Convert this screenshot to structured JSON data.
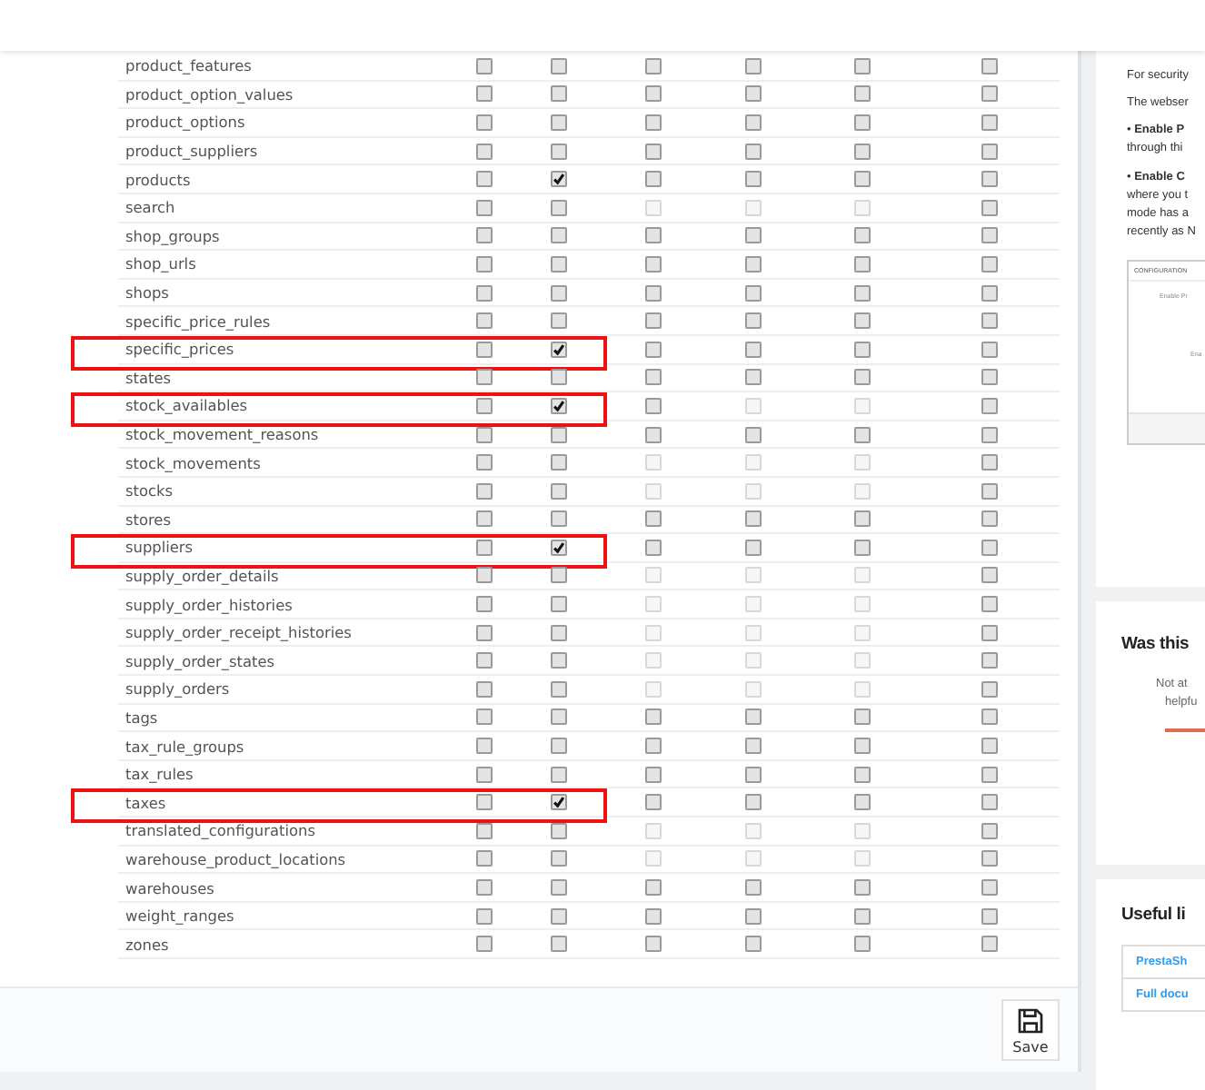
{
  "table": {
    "rows": [
      {
        "name": "product_features",
        "highlighted": false,
        "checked": [
          false,
          false,
          false,
          false,
          false,
          false
        ],
        "disabled": [
          false,
          false,
          false,
          false,
          false,
          false
        ]
      },
      {
        "name": "product_option_values",
        "highlighted": false,
        "checked": [
          false,
          false,
          false,
          false,
          false,
          false
        ],
        "disabled": [
          false,
          false,
          false,
          false,
          false,
          false
        ]
      },
      {
        "name": "product_options",
        "highlighted": false,
        "checked": [
          false,
          false,
          false,
          false,
          false,
          false
        ],
        "disabled": [
          false,
          false,
          false,
          false,
          false,
          false
        ]
      },
      {
        "name": "product_suppliers",
        "highlighted": false,
        "checked": [
          false,
          false,
          false,
          false,
          false,
          false
        ],
        "disabled": [
          false,
          false,
          false,
          false,
          false,
          false
        ]
      },
      {
        "name": "products",
        "highlighted": false,
        "checked": [
          false,
          true,
          false,
          false,
          false,
          false
        ],
        "disabled": [
          false,
          false,
          false,
          false,
          false,
          false
        ]
      },
      {
        "name": "search",
        "highlighted": false,
        "checked": [
          false,
          false,
          false,
          false,
          false,
          false
        ],
        "disabled": [
          false,
          false,
          true,
          true,
          true,
          false
        ]
      },
      {
        "name": "shop_groups",
        "highlighted": false,
        "checked": [
          false,
          false,
          false,
          false,
          false,
          false
        ],
        "disabled": [
          false,
          false,
          false,
          false,
          false,
          false
        ]
      },
      {
        "name": "shop_urls",
        "highlighted": false,
        "checked": [
          false,
          false,
          false,
          false,
          false,
          false
        ],
        "disabled": [
          false,
          false,
          false,
          false,
          false,
          false
        ]
      },
      {
        "name": "shops",
        "highlighted": false,
        "checked": [
          false,
          false,
          false,
          false,
          false,
          false
        ],
        "disabled": [
          false,
          false,
          false,
          false,
          false,
          false
        ]
      },
      {
        "name": "specific_price_rules",
        "highlighted": false,
        "checked": [
          false,
          false,
          false,
          false,
          false,
          false
        ],
        "disabled": [
          false,
          false,
          false,
          false,
          false,
          false
        ]
      },
      {
        "name": "specific_prices",
        "highlighted": true,
        "checked": [
          false,
          true,
          false,
          false,
          false,
          false
        ],
        "disabled": [
          false,
          false,
          false,
          false,
          false,
          false
        ]
      },
      {
        "name": "states",
        "highlighted": false,
        "checked": [
          false,
          false,
          false,
          false,
          false,
          false
        ],
        "disabled": [
          false,
          false,
          false,
          false,
          false,
          false
        ]
      },
      {
        "name": "stock_availables",
        "highlighted": true,
        "checked": [
          false,
          true,
          false,
          false,
          false,
          false
        ],
        "disabled": [
          false,
          false,
          false,
          true,
          true,
          false
        ]
      },
      {
        "name": "stock_movement_reasons",
        "highlighted": false,
        "checked": [
          false,
          false,
          false,
          false,
          false,
          false
        ],
        "disabled": [
          false,
          false,
          false,
          false,
          false,
          false
        ]
      },
      {
        "name": "stock_movements",
        "highlighted": false,
        "checked": [
          false,
          false,
          false,
          false,
          false,
          false
        ],
        "disabled": [
          false,
          false,
          true,
          true,
          true,
          false
        ]
      },
      {
        "name": "stocks",
        "highlighted": false,
        "checked": [
          false,
          false,
          false,
          false,
          false,
          false
        ],
        "disabled": [
          false,
          false,
          true,
          true,
          true,
          false
        ]
      },
      {
        "name": "stores",
        "highlighted": false,
        "checked": [
          false,
          false,
          false,
          false,
          false,
          false
        ],
        "disabled": [
          false,
          false,
          false,
          false,
          false,
          false
        ]
      },
      {
        "name": "suppliers",
        "highlighted": true,
        "checked": [
          false,
          true,
          false,
          false,
          false,
          false
        ],
        "disabled": [
          false,
          false,
          false,
          false,
          false,
          false
        ]
      },
      {
        "name": "supply_order_details",
        "highlighted": false,
        "checked": [
          false,
          false,
          false,
          false,
          false,
          false
        ],
        "disabled": [
          false,
          false,
          true,
          true,
          true,
          false
        ]
      },
      {
        "name": "supply_order_histories",
        "highlighted": false,
        "checked": [
          false,
          false,
          false,
          false,
          false,
          false
        ],
        "disabled": [
          false,
          false,
          true,
          true,
          true,
          false
        ]
      },
      {
        "name": "supply_order_receipt_histories",
        "highlighted": false,
        "checked": [
          false,
          false,
          false,
          false,
          false,
          false
        ],
        "disabled": [
          false,
          false,
          true,
          true,
          true,
          false
        ]
      },
      {
        "name": "supply_order_states",
        "highlighted": false,
        "checked": [
          false,
          false,
          false,
          false,
          false,
          false
        ],
        "disabled": [
          false,
          false,
          true,
          true,
          true,
          false
        ]
      },
      {
        "name": "supply_orders",
        "highlighted": false,
        "checked": [
          false,
          false,
          false,
          false,
          false,
          false
        ],
        "disabled": [
          false,
          false,
          true,
          true,
          true,
          false
        ]
      },
      {
        "name": "tags",
        "highlighted": false,
        "checked": [
          false,
          false,
          false,
          false,
          false,
          false
        ],
        "disabled": [
          false,
          false,
          false,
          false,
          false,
          false
        ]
      },
      {
        "name": "tax_rule_groups",
        "highlighted": false,
        "checked": [
          false,
          false,
          false,
          false,
          false,
          false
        ],
        "disabled": [
          false,
          false,
          false,
          false,
          false,
          false
        ]
      },
      {
        "name": "tax_rules",
        "highlighted": false,
        "checked": [
          false,
          false,
          false,
          false,
          false,
          false
        ],
        "disabled": [
          false,
          false,
          false,
          false,
          false,
          false
        ]
      },
      {
        "name": "taxes",
        "highlighted": true,
        "checked": [
          false,
          true,
          false,
          false,
          false,
          false
        ],
        "disabled": [
          false,
          false,
          false,
          false,
          false,
          false
        ]
      },
      {
        "name": "translated_configurations",
        "highlighted": false,
        "checked": [
          false,
          false,
          false,
          false,
          false,
          false
        ],
        "disabled": [
          false,
          false,
          true,
          true,
          true,
          false
        ]
      },
      {
        "name": "warehouse_product_locations",
        "highlighted": false,
        "checked": [
          false,
          false,
          false,
          false,
          false,
          false
        ],
        "disabled": [
          false,
          false,
          true,
          true,
          true,
          false
        ]
      },
      {
        "name": "warehouses",
        "highlighted": false,
        "checked": [
          false,
          false,
          false,
          false,
          false,
          false
        ],
        "disabled": [
          false,
          false,
          false,
          false,
          false,
          false
        ]
      },
      {
        "name": "weight_ranges",
        "highlighted": false,
        "checked": [
          false,
          false,
          false,
          false,
          false,
          false
        ],
        "disabled": [
          false,
          false,
          false,
          false,
          false,
          false
        ]
      },
      {
        "name": "zones",
        "highlighted": false,
        "checked": [
          false,
          false,
          false,
          false,
          false,
          false
        ],
        "disabled": [
          false,
          false,
          false,
          false,
          false,
          false
        ]
      }
    ]
  },
  "footer": {
    "save_label": "Save"
  },
  "sidebar": {
    "article": {
      "paragraphs": [
        {
          "lines": [
            "For security"
          ]
        },
        {
          "lines": [
            "The webser"
          ]
        },
        {
          "bullet": "•",
          "bold": "Enable P",
          "lines": [
            "through thi"
          ]
        },
        {
          "bullet": "•",
          "bold": "Enable C",
          "lines": [
            "where you t",
            "mode has a",
            "recently as N"
          ]
        }
      ],
      "screenshot": {
        "title": "CONFIGURATION",
        "labels": [
          "Enable Pr",
          "Ena"
        ]
      }
    },
    "feedback": {
      "title": "Was this",
      "lines": [
        "Not at",
        "helpfu"
      ]
    },
    "links": {
      "title": "Useful li",
      "items": [
        "PrestaSh",
        "Full docu"
      ]
    }
  }
}
